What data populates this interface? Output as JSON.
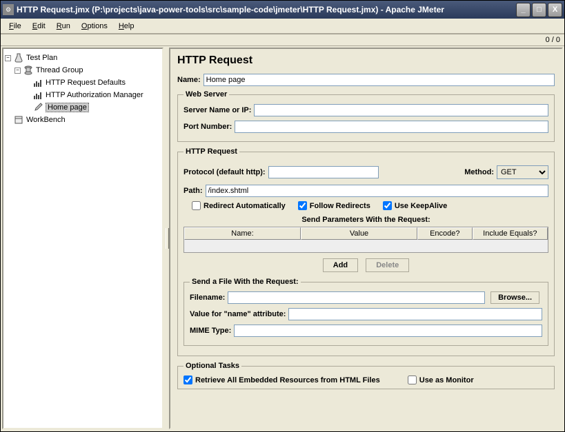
{
  "window": {
    "title": "HTTP Request.jmx (P:\\projects\\java-power-tools\\src\\sample-code\\jmeter\\HTTP Request.jmx) - Apache JMeter",
    "minimize": "_",
    "maximize": "□",
    "close": "X"
  },
  "menu": {
    "file": "File",
    "edit": "Edit",
    "run": "Run",
    "options": "Options",
    "help": "Help"
  },
  "status": {
    "counter": "0 / 0"
  },
  "tree": {
    "testplan": "Test Plan",
    "threadgroup": "Thread Group",
    "http_defaults": "HTTP Request Defaults",
    "http_auth": "HTTP Authorization Manager",
    "home_page": "Home page",
    "workbench": "WorkBench"
  },
  "panel": {
    "title": "HTTP Request",
    "name_label": "Name:",
    "name_value": "Home page",
    "webserver": {
      "legend": "Web Server",
      "server_label": "Server Name or IP:",
      "server_value": "",
      "port_label": "Port Number:",
      "port_value": ""
    },
    "httprequest": {
      "legend": "HTTP Request",
      "protocol_label": "Protocol (default http):",
      "protocol_value": "",
      "method_label": "Method:",
      "method_value": "GET",
      "path_label": "Path:",
      "path_value": "/index.shtml",
      "redirect_auto": "Redirect Automatically",
      "follow_redirects": "Follow Redirects",
      "keepalive": "Use KeepAlive",
      "params_title": "Send Parameters With the Request:",
      "col_name": "Name:",
      "col_value": "Value",
      "col_encode": "Encode?",
      "col_include": "Include Equals?",
      "add_btn": "Add",
      "delete_btn": "Delete"
    },
    "sendfile": {
      "legend": "Send a File With the Request:",
      "filename_label": "Filename:",
      "filename_value": "",
      "browse_btn": "Browse...",
      "nameattr_label": "Value for \"name\" attribute:",
      "nameattr_value": "",
      "mime_label": "MIME Type:",
      "mime_value": ""
    },
    "optional": {
      "legend": "Optional Tasks",
      "retrieve": "Retrieve All Embedded Resources from HTML Files",
      "monitor": "Use as Monitor"
    }
  }
}
